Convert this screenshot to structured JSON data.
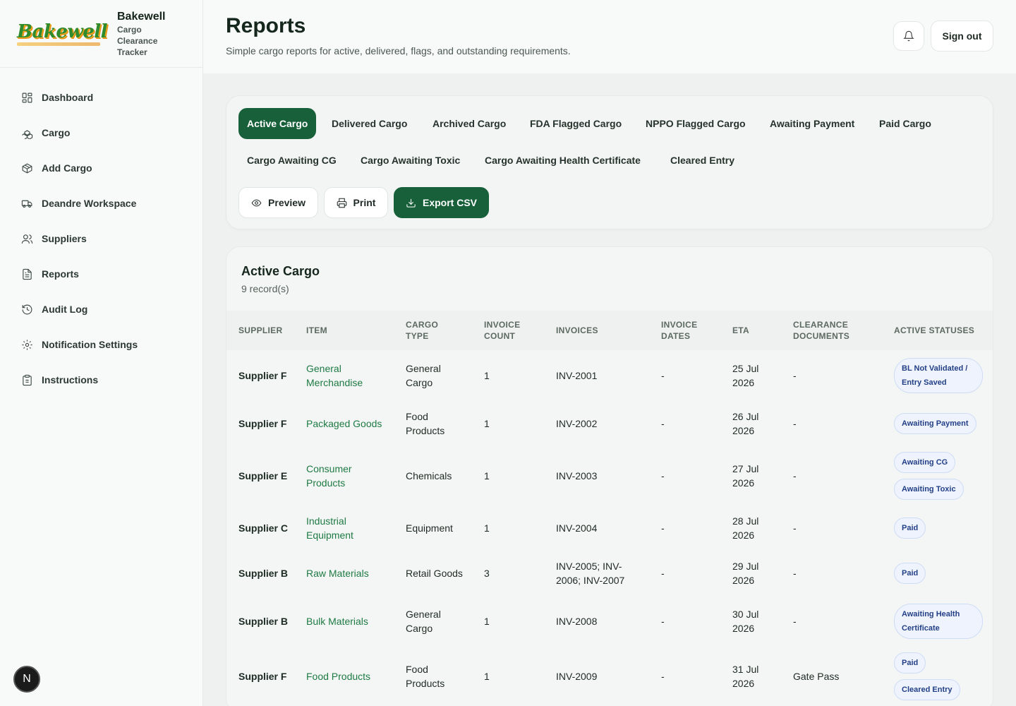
{
  "brand": {
    "logo_text": "Bakewell",
    "name": "Bakewell",
    "subtitle": "Cargo Clearance Tracker"
  },
  "sidebar": {
    "items": [
      {
        "label": "Dashboard",
        "icon": "dashboard-grid-icon"
      },
      {
        "label": "Cargo",
        "icon": "boxes-icon"
      },
      {
        "label": "Add Cargo",
        "icon": "package-plus-icon"
      },
      {
        "label": "Deandre Workspace",
        "icon": "truck-icon"
      },
      {
        "label": "Suppliers",
        "icon": "users-icon"
      },
      {
        "label": "Reports",
        "icon": "file-text-icon"
      },
      {
        "label": "Audit Log",
        "icon": "history-icon"
      },
      {
        "label": "Notification Settings",
        "icon": "gear-icon"
      },
      {
        "label": "Instructions",
        "icon": "clipboard-icon"
      }
    ],
    "badge": "N"
  },
  "header": {
    "title": "Reports",
    "subtitle": "Simple cargo reports for active, delivered, flags, and outstanding requirements.",
    "sign_out": "Sign out"
  },
  "tabs": [
    "Active Cargo",
    "Delivered Cargo",
    "Archived Cargo",
    "FDA Flagged Cargo",
    "NPPO Flagged Cargo",
    "Awaiting Payment",
    "Paid Cargo",
    "Cargo Awaiting CG",
    "Cargo Awaiting Toxic",
    "Cargo Awaiting Health Certificate",
    "Cleared Entry"
  ],
  "actions": {
    "preview": "Preview",
    "print": "Print",
    "export": "Export CSV"
  },
  "table": {
    "title": "Active Cargo",
    "count": "9 record(s)",
    "headers": [
      "SUPPLIER",
      "ITEM",
      "CARGO TYPE",
      "INVOICE COUNT",
      "INVOICES",
      "INVOICE DATES",
      "ETA",
      "CLEARANCE DOCUMENTS",
      "ACTIVE STATUSES"
    ],
    "rows": [
      {
        "supplier": "Supplier F",
        "item": "General Merchandise",
        "type": "General Cargo",
        "count": "1",
        "invoices": "INV-2001",
        "dates": "-",
        "eta": "25 Jul 2026",
        "docs": "-",
        "statuses": [
          "BL Not Validated / Entry Saved"
        ]
      },
      {
        "supplier": "Supplier F",
        "item": "Packaged Goods",
        "type": "Food Products",
        "count": "1",
        "invoices": "INV-2002",
        "dates": "-",
        "eta": "26 Jul 2026",
        "docs": "-",
        "statuses": [
          "Awaiting Payment"
        ]
      },
      {
        "supplier": "Supplier E",
        "item": "Consumer Products",
        "type": "Chemicals",
        "count": "1",
        "invoices": "INV-2003",
        "dates": "-",
        "eta": "27 Jul 2026",
        "docs": "-",
        "statuses": [
          "Awaiting CG",
          "Awaiting Toxic"
        ]
      },
      {
        "supplier": "Supplier C",
        "item": "Industrial Equipment",
        "type": "Equipment",
        "count": "1",
        "invoices": "INV-2004",
        "dates": "-",
        "eta": "28 Jul 2026",
        "docs": "-",
        "statuses": [
          "Paid"
        ]
      },
      {
        "supplier": "Supplier B",
        "item": "Raw Materials",
        "type": "Retail Goods",
        "count": "3",
        "invoices": "INV-2005; INV-2006; INV-2007",
        "dates": "-",
        "eta": "29 Jul 2026",
        "docs": "-",
        "statuses": [
          "Paid"
        ]
      },
      {
        "supplier": "Supplier B",
        "item": "Bulk Materials",
        "type": "General Cargo",
        "count": "1",
        "invoices": "INV-2008",
        "dates": "-",
        "eta": "30 Jul 2026",
        "docs": "-",
        "statuses": [
          "Awaiting Health Certificate"
        ]
      },
      {
        "supplier": "Supplier F",
        "item": "Food Products",
        "type": "Food Products",
        "count": "1",
        "invoices": "INV-2009",
        "dates": "-",
        "eta": "31 Jul 2026",
        "docs": "Gate Pass",
        "statuses": [
          "Paid",
          "Cleared Entry"
        ]
      }
    ]
  },
  "colors": {
    "accent": "#17603a",
    "item_link": "#1e7a43",
    "badge_text": "#233f86",
    "badge_bg": "#eef3fd",
    "badge_border": "#cfdcf5"
  }
}
